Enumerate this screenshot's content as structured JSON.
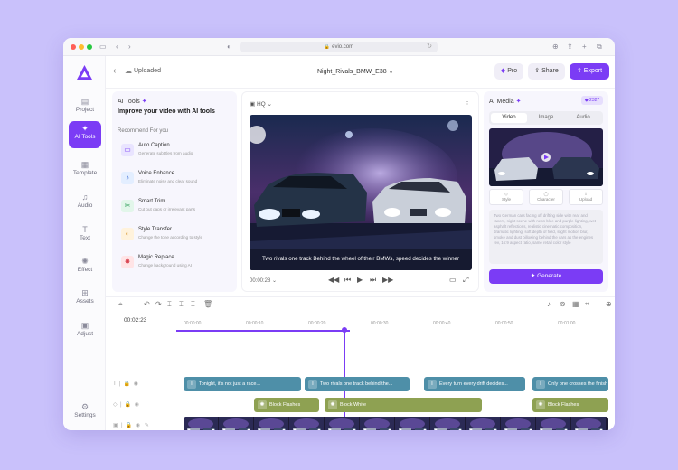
{
  "browser": {
    "url": "evio.com"
  },
  "sidebar": {
    "items": [
      {
        "label": "Project",
        "icon": "folder-icon"
      },
      {
        "label": "AI Tools",
        "icon": "sparkle-icon"
      },
      {
        "label": "Template",
        "icon": "grid-icon"
      },
      {
        "label": "Audio",
        "icon": "music-note-icon"
      },
      {
        "label": "Text",
        "icon": "text-icon"
      },
      {
        "label": "Effect",
        "icon": "effect-icon"
      },
      {
        "label": "Assets",
        "icon": "assets-icon"
      },
      {
        "label": "Adjust",
        "icon": "adjust-icon"
      }
    ],
    "settings_label": "Settings"
  },
  "topbar": {
    "status": "Uploaded",
    "project_title": "Night_Rivals_BMW_E38",
    "pro_label": "Pro",
    "share_label": "Share",
    "export_label": "Export"
  },
  "ai_tools": {
    "title": "AI Tools",
    "subtitle": "Improve your video with AI tools",
    "section": "Recommend For you",
    "tools": [
      {
        "name": "Auto Caption",
        "desc": "Generate subtitles from audio",
        "color": "#e9e4ff",
        "icon": "caption-icon"
      },
      {
        "name": "Voice Enhance",
        "desc": "Eliminate noise and clear sound",
        "color": "#e3eeff",
        "icon": "mic-icon"
      },
      {
        "name": "Smart Trim",
        "desc": "Cut out gaps or irrelevant parts",
        "color": "#e2f6ea",
        "icon": "scissors-icon"
      },
      {
        "name": "Style Transfer",
        "desc": "Change the tone according to style",
        "color": "#fff2dc",
        "icon": "palette-icon"
      },
      {
        "name": "Magic Replace",
        "desc": "Change background using AI",
        "color": "#ffe4e6",
        "icon": "wand-icon"
      }
    ]
  },
  "preview": {
    "quality": "HQ",
    "caption": "Two rivals one track Behind the wheel of their BMWs, speed decides the winner",
    "timecode": "00:00:28"
  },
  "ai_media": {
    "title": "AI Media",
    "tabs": [
      "Video",
      "Image",
      "Audio"
    ],
    "active_tab": "Video",
    "buttons": [
      "Style",
      "Character",
      "Upload"
    ],
    "prompt": "Two German cars facing off drifting side with rear and racers, night scene with neon blue and purple lighting, wet asphalt reflections, realistic cinematic composition, dramatic lighting, soft depth of field, slight motion blur, smoke and dust billowing behind the cars as the engines rev, 16:9 aspect ratio, same retail color style",
    "generate_label": "Generate"
  },
  "timeline": {
    "current_time": "00:02:23",
    "ticks": [
      "00:00:00",
      "00:00:10",
      "00:00:20",
      "00:00:30",
      "00:00:40",
      "00:00:50",
      "00:01:00"
    ],
    "progress_fraction": 0.39,
    "text_clips": [
      "Tonight, it's not just a race...",
      "Two rivals one track behind the...",
      "Every turn every drift decides...",
      "Only one crosses the finish"
    ],
    "effect_clips": [
      "Block Flashes",
      "Block White",
      "Block Flashes"
    ]
  }
}
